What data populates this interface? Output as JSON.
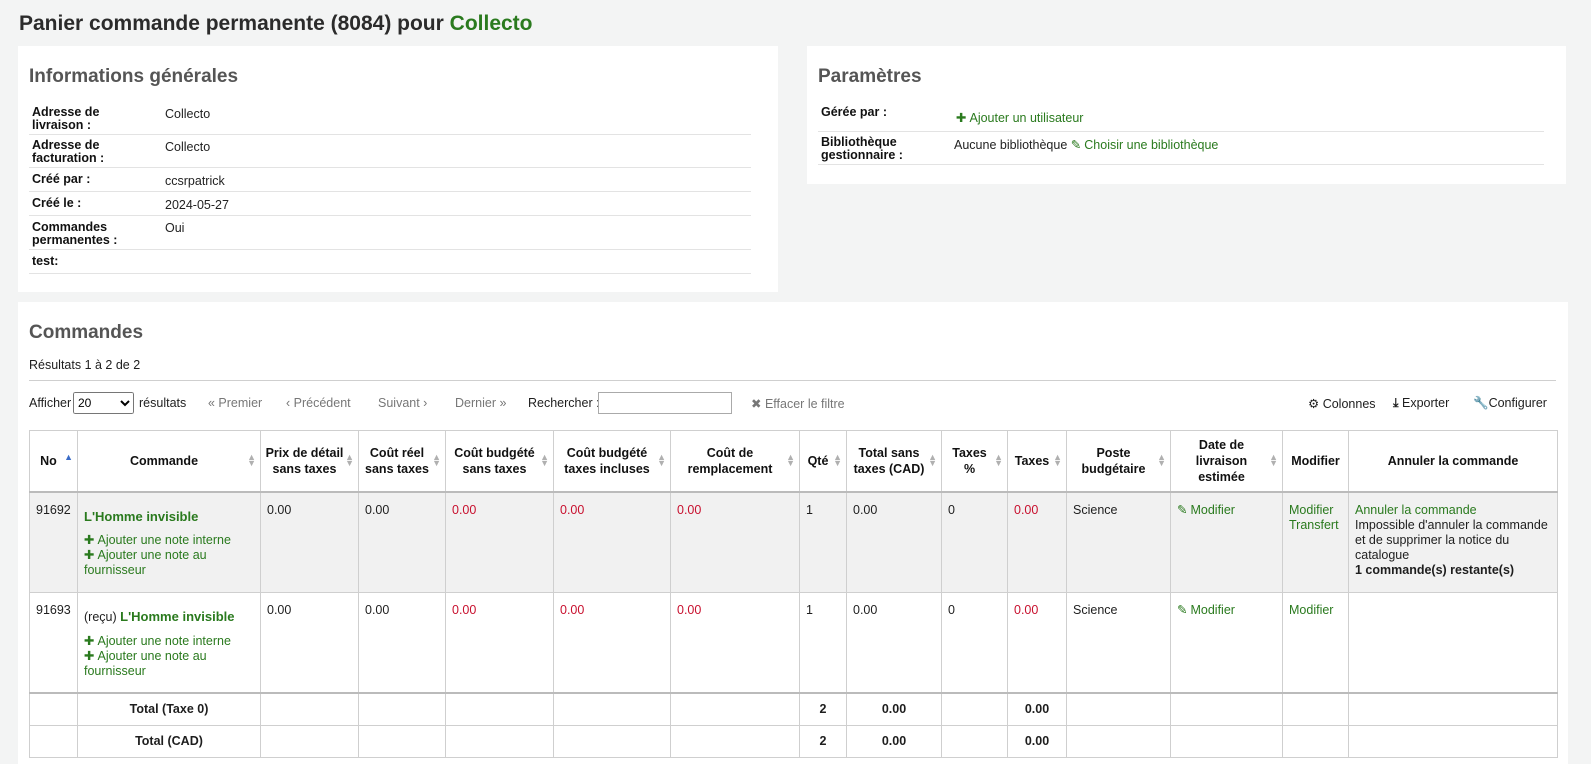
{
  "page": {
    "title_prefix": "Panier commande permanente (8084) pour",
    "vendor": "Collecto"
  },
  "info": {
    "heading": "Informations générales",
    "rows": [
      {
        "label_1": "Adresse de",
        "label_2": "livraison :",
        "value": "Collecto"
      },
      {
        "label_1": "Adresse de",
        "label_2": "facturation :",
        "value": "Collecto"
      },
      {
        "label_1": "Créé par :",
        "label_2": "",
        "value": "ccsrpatrick"
      },
      {
        "label_1": "Créé le :",
        "label_2": "",
        "value": "2024-05-27"
      },
      {
        "label_1": "Commandes",
        "label_2": "permanentes :",
        "value": "Oui"
      },
      {
        "label_1": "test:",
        "label_2": "",
        "value": ""
      }
    ]
  },
  "params": {
    "heading": "Paramètres",
    "managed_label": "Gérée par :",
    "add_user": "Ajouter un utilisateur",
    "library_label_1": "Bibliothèque",
    "library_label_2": "gestionnaire :",
    "library_value": "Aucune bibliothèque",
    "choose_library": "Choisir une bibliothèque"
  },
  "orders": {
    "heading": "Commandes",
    "results": "Résultats 1 à 2 de 2",
    "show_label": "Afficher",
    "page_size": "20",
    "results_label": "résultats",
    "first": "« Premier",
    "previous": "‹ Précédent",
    "next": "Suivant ›",
    "last": "Dernier »",
    "search_label": "Rechercher :",
    "search_value": "",
    "clear_filter": "Effacer le filtre",
    "columns_btn": "Colonnes",
    "export_btn": "Exporter",
    "configure_btn": "Configurer",
    "headers": {
      "no": "No",
      "order": "Commande",
      "retail": "Prix de détail sans taxes",
      "actual": "Coût réel sans taxes",
      "budgeted_ex": "Coût budgété sans taxes",
      "budgeted_inc": "Coût budgété taxes incluses",
      "replacement": "Coût de remplacement",
      "qty": "Qté",
      "total": "Total sans taxes (CAD)",
      "tax_pct": "Taxes %",
      "tax": "Taxes",
      "fund": "Poste budgétaire",
      "delivery": "Date de livraison estimée",
      "modify": "Modifier",
      "cancel": "Annuler la commande"
    },
    "rows": [
      {
        "no": "91692",
        "received": "",
        "title": "L'Homme invisible",
        "add_internal": "Ajouter une note interne",
        "add_vendor": "Ajouter une note au fournisseur",
        "retail": "0.00",
        "actual": "0.00",
        "budgeted_ex": "0.00",
        "budgeted_inc": "0.00",
        "replacement": "0.00",
        "qty": "1",
        "total": "0.00",
        "tax_pct": "0",
        "tax": "0.00",
        "fund": "Science",
        "delivery": "Modifier",
        "modify": "Modifier",
        "transfer": "Transfert",
        "cancel_link": "Annuler la commande",
        "cancel_note": "Impossible d'annuler la commande et de supprimer la notice du catalogue",
        "remaining": "1 commande(s) restante(s)"
      },
      {
        "no": "91693",
        "received": "(reçu)",
        "title": "L'Homme invisible",
        "add_internal": "Ajouter une note interne",
        "add_vendor": "Ajouter une note au fournisseur",
        "retail": "0.00",
        "actual": "0.00",
        "budgeted_ex": "0.00",
        "budgeted_inc": "0.00",
        "replacement": "0.00",
        "qty": "1",
        "total": "0.00",
        "tax_pct": "0",
        "tax": "0.00",
        "fund": "Science",
        "delivery": "Modifier",
        "modify": "Modifier"
      }
    ],
    "totals": [
      {
        "label": "Total (Taxe 0)",
        "qty": "2",
        "total": "0.00",
        "tax": "0.00"
      },
      {
        "label": "Total (CAD)",
        "qty": "2",
        "total": "0.00",
        "tax": "0.00"
      }
    ]
  }
}
